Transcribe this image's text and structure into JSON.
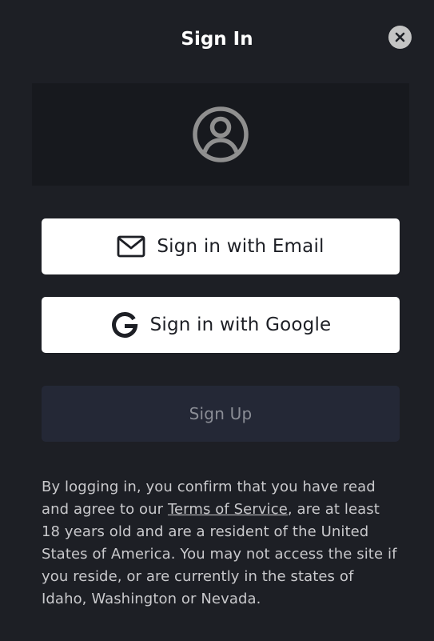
{
  "header": {
    "title": "Sign In",
    "close_icon": "close-icon"
  },
  "avatar": {
    "icon": "user-circle-icon",
    "color": "#8f8f8f"
  },
  "buttons": {
    "email": {
      "label": "Sign in with Email",
      "icon": "mail-icon"
    },
    "google": {
      "label": "Sign in with Google",
      "icon": "google-icon"
    },
    "signup": {
      "label": "Sign Up"
    }
  },
  "legal": {
    "text_before": "By logging in, you confirm that you have read and agree to our ",
    "terms_link": "Terms of Service",
    "text_after": ", are at least  18 years old and are a resident of the United States of America. You may not access the site if you reside, or are currently in the states of Idaho, Washington or Nevada."
  },
  "colors": {
    "background": "#1d1f25",
    "panel": "#17191e",
    "button": "#ffffff",
    "signup_button": "#242836",
    "text": "#ffffff",
    "muted_text": "#c9c9cc"
  }
}
